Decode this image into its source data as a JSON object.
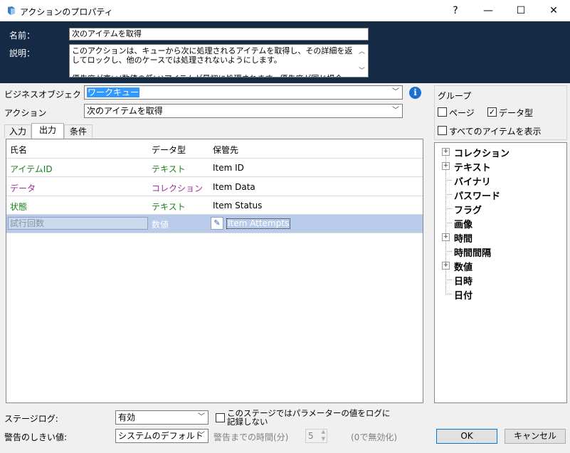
{
  "window": {
    "title": "アクションのプロパティ",
    "help": "?",
    "minimize": "—",
    "maximize": "☐",
    "close": "✕"
  },
  "header": {
    "name_label": "名前：",
    "name_value": "次のアイテムを取得",
    "desc_label": "説明：",
    "desc_value": "このアクションは、キューから次に処理されるアイテムを取得し、その詳細を返してロックし、他のケースでは処理されないようにします。\n\n優先度が高い(数値の低い)アイテムが最初に処理されます。優先度が同じ場合、キ"
  },
  "form": {
    "business_object_label": "ビジネスオブジェクト",
    "business_object_value": "ワークキュー",
    "action_label": "アクション",
    "action_value": "次のアイテムを取得"
  },
  "tabs": [
    "入力",
    "出力",
    "条件"
  ],
  "grid": {
    "headers": [
      "氏名",
      "データ型",
      "保管先"
    ],
    "rows": [
      {
        "name": "アイテムID",
        "type": "テキスト",
        "store": "Item ID"
      },
      {
        "name": "データ",
        "type": "コレクション",
        "store": "Item Data"
      },
      {
        "name": "状態",
        "type": "テキスト",
        "store": "Item Status"
      },
      {
        "name": "試行回数",
        "type": "数値",
        "store": "Item Attempts"
      }
    ]
  },
  "group": {
    "title": "グループ",
    "page_label": "ページ",
    "page_checked": false,
    "datatype_label": "データ型",
    "datatype_checked": true,
    "show_all_label": "すべてのアイテムを表示",
    "show_all_checked": false
  },
  "tree": [
    {
      "label": "コレクション",
      "expandable": true
    },
    {
      "label": "テキスト",
      "expandable": true
    },
    {
      "label": "バイナリ",
      "expandable": false
    },
    {
      "label": "パスワード",
      "expandable": false
    },
    {
      "label": "フラグ",
      "expandable": false
    },
    {
      "label": "画像",
      "expandable": false
    },
    {
      "label": "時間",
      "expandable": true
    },
    {
      "label": "時間間隔",
      "expandable": false
    },
    {
      "label": "数値",
      "expandable": true
    },
    {
      "label": "日時",
      "expandable": false
    },
    {
      "label": "日付",
      "expandable": false
    }
  ],
  "bottom": {
    "stage_log_label": "ステージログ:",
    "stage_log_value": "有効",
    "log_params_label": "このステージではパラメーターの値をログに記録しない",
    "warning_label": "警告のしきい値:",
    "warning_value": "システムのデフォルト",
    "warning_time_label": "警告までの時間(分)",
    "warning_time_value": "5",
    "warning_hint": "(0で無効化)",
    "ok": "OK",
    "cancel": "キャンセル"
  },
  "colors": {
    "header_bg": "#152a44",
    "green_text": "#1a7f1a",
    "purple_text": "#9b2c9b",
    "selection_row": "#b8cbe8"
  }
}
